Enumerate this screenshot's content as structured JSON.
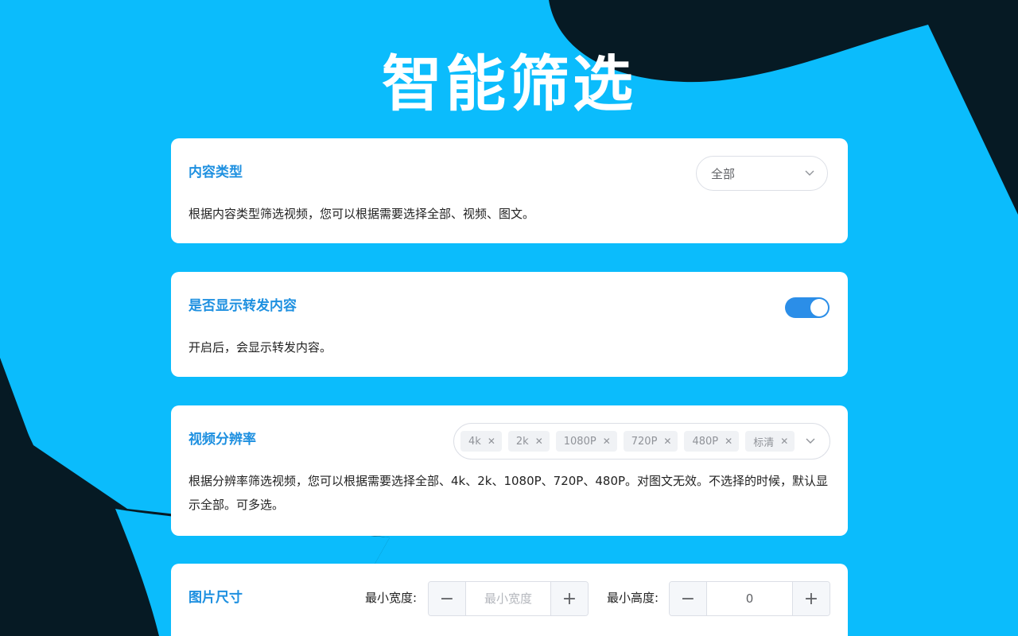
{
  "page": {
    "title": "智能筛选"
  },
  "content_type": {
    "title": "内容类型",
    "desc": "根据内容类型筛选视频，您可以根据需要选择全部、视频、图文。",
    "selected": "全部"
  },
  "repost": {
    "title": "是否显示转发内容",
    "desc": "开启后，会显示转发内容。",
    "enabled": true
  },
  "resolution": {
    "title": "视频分辨率",
    "desc": "根据分辨率筛选视频，您可以根据需要选择全部、4k、2k、1080P、720P、480P。对图文无效。不选择的时候，默认显示全部。可多选。",
    "tags": [
      "4k",
      "2k",
      "1080P",
      "720P",
      "480P",
      "标清"
    ]
  },
  "image_size": {
    "title": "图片尺寸",
    "min_width_label": "最小宽度:",
    "min_width_placeholder": "最小宽度",
    "min_height_label": "最小高度:",
    "min_height_value": "0",
    "minus": "−",
    "plus": "+"
  },
  "colors": {
    "background": "#0bbcfc",
    "dark_shape": "#061a24",
    "accent": "#1e90e0",
    "toggle_on": "#2b8ee8"
  },
  "icons": {
    "dropdown": "chevron-down-icon",
    "tag_remove": "close-icon"
  }
}
